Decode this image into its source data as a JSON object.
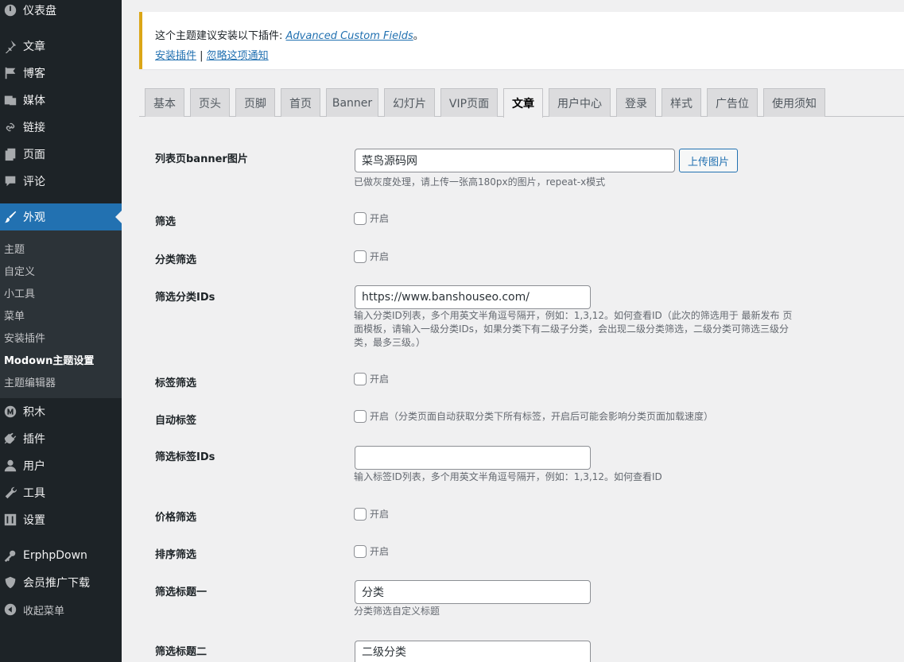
{
  "sidebar": {
    "items": [
      {
        "label": "仪表盘",
        "icon": "dashboard-icon"
      },
      {
        "label": "文章",
        "icon": "pin-icon"
      },
      {
        "label": "博客",
        "icon": "flag-icon"
      },
      {
        "label": "媒体",
        "icon": "media-icon"
      },
      {
        "label": "链接",
        "icon": "link-icon"
      },
      {
        "label": "页面",
        "icon": "page-icon"
      },
      {
        "label": "评论",
        "icon": "comment-icon"
      },
      {
        "label": "外观",
        "icon": "brush-icon"
      },
      {
        "label": "积木",
        "icon": "blocks-icon"
      },
      {
        "label": "插件",
        "icon": "plugin-icon"
      },
      {
        "label": "用户",
        "icon": "user-icon"
      },
      {
        "label": "工具",
        "icon": "wrench-icon"
      },
      {
        "label": "设置",
        "icon": "settings-icon"
      },
      {
        "label": "ErphpDown",
        "icon": "key-icon"
      },
      {
        "label": "会员推广下载",
        "icon": "shield-icon"
      },
      {
        "label": "收起菜单",
        "icon": "collapse-icon"
      }
    ],
    "submenu": [
      "主题",
      "自定义",
      "小工具",
      "菜单",
      "安装插件",
      "Modown主题设置",
      "主题编辑器"
    ],
    "accent": "#2271b1"
  },
  "notice": {
    "text": "这个主题建议安装以下插件: ",
    "plugin": "Advanced Custom Fields",
    "suffix": "。",
    "install": "安装插件",
    "separator": " | ",
    "dismiss": "忽略这项通知"
  },
  "tabs": [
    "基本",
    "页头",
    "页脚",
    "首页",
    "Banner",
    "幻灯片",
    "VIP页面",
    "文章",
    "用户中心",
    "登录",
    "样式",
    "广告位",
    "使用须知"
  ],
  "form": {
    "banner_label": "列表页banner图片",
    "banner_value": "菜鸟源码网",
    "upload_label": "上传图片",
    "banner_desc": "已做灰度处理，请上传一张高180px的图片，repeat-x模式",
    "filter_label": "筛选",
    "cat_filter_label": "分类筛选",
    "cat_ids_label": "筛选分类IDs",
    "cat_ids_value": "https://www.banshouseo.com/",
    "cat_ids_desc": "输入分类ID列表，多个用英文半角逗号隔开，例如：1,3,12。如何查看ID（此次的筛选用于 最新发布 页面模板，请输入一级分类IDs，如果分类下有二级子分类，会出现二级分类筛选，二级分类可筛选三级分类，最多三级。）",
    "tag_filter_label": "标签筛选",
    "auto_tag_label": "自动标签",
    "auto_tag_option": "开启（分类页面自动获取分类下所有标签，开启后可能会影响分类页面加载速度）",
    "tag_ids_label": "筛选标签IDs",
    "tag_ids_value": "",
    "tag_ids_desc": "输入标签ID列表，多个用英文半角逗号隔开，例如：1,3,12。如何查看ID",
    "price_filter_label": "价格筛选",
    "sort_filter_label": "排序筛选",
    "filter_title1_label": "筛选标题一",
    "filter_title1_value": "分类",
    "filter_title1_desc": "分类筛选自定义标题",
    "filter_title2_label": "筛选标题二",
    "filter_title2_value": "二级分类",
    "enable_label": "开启"
  }
}
